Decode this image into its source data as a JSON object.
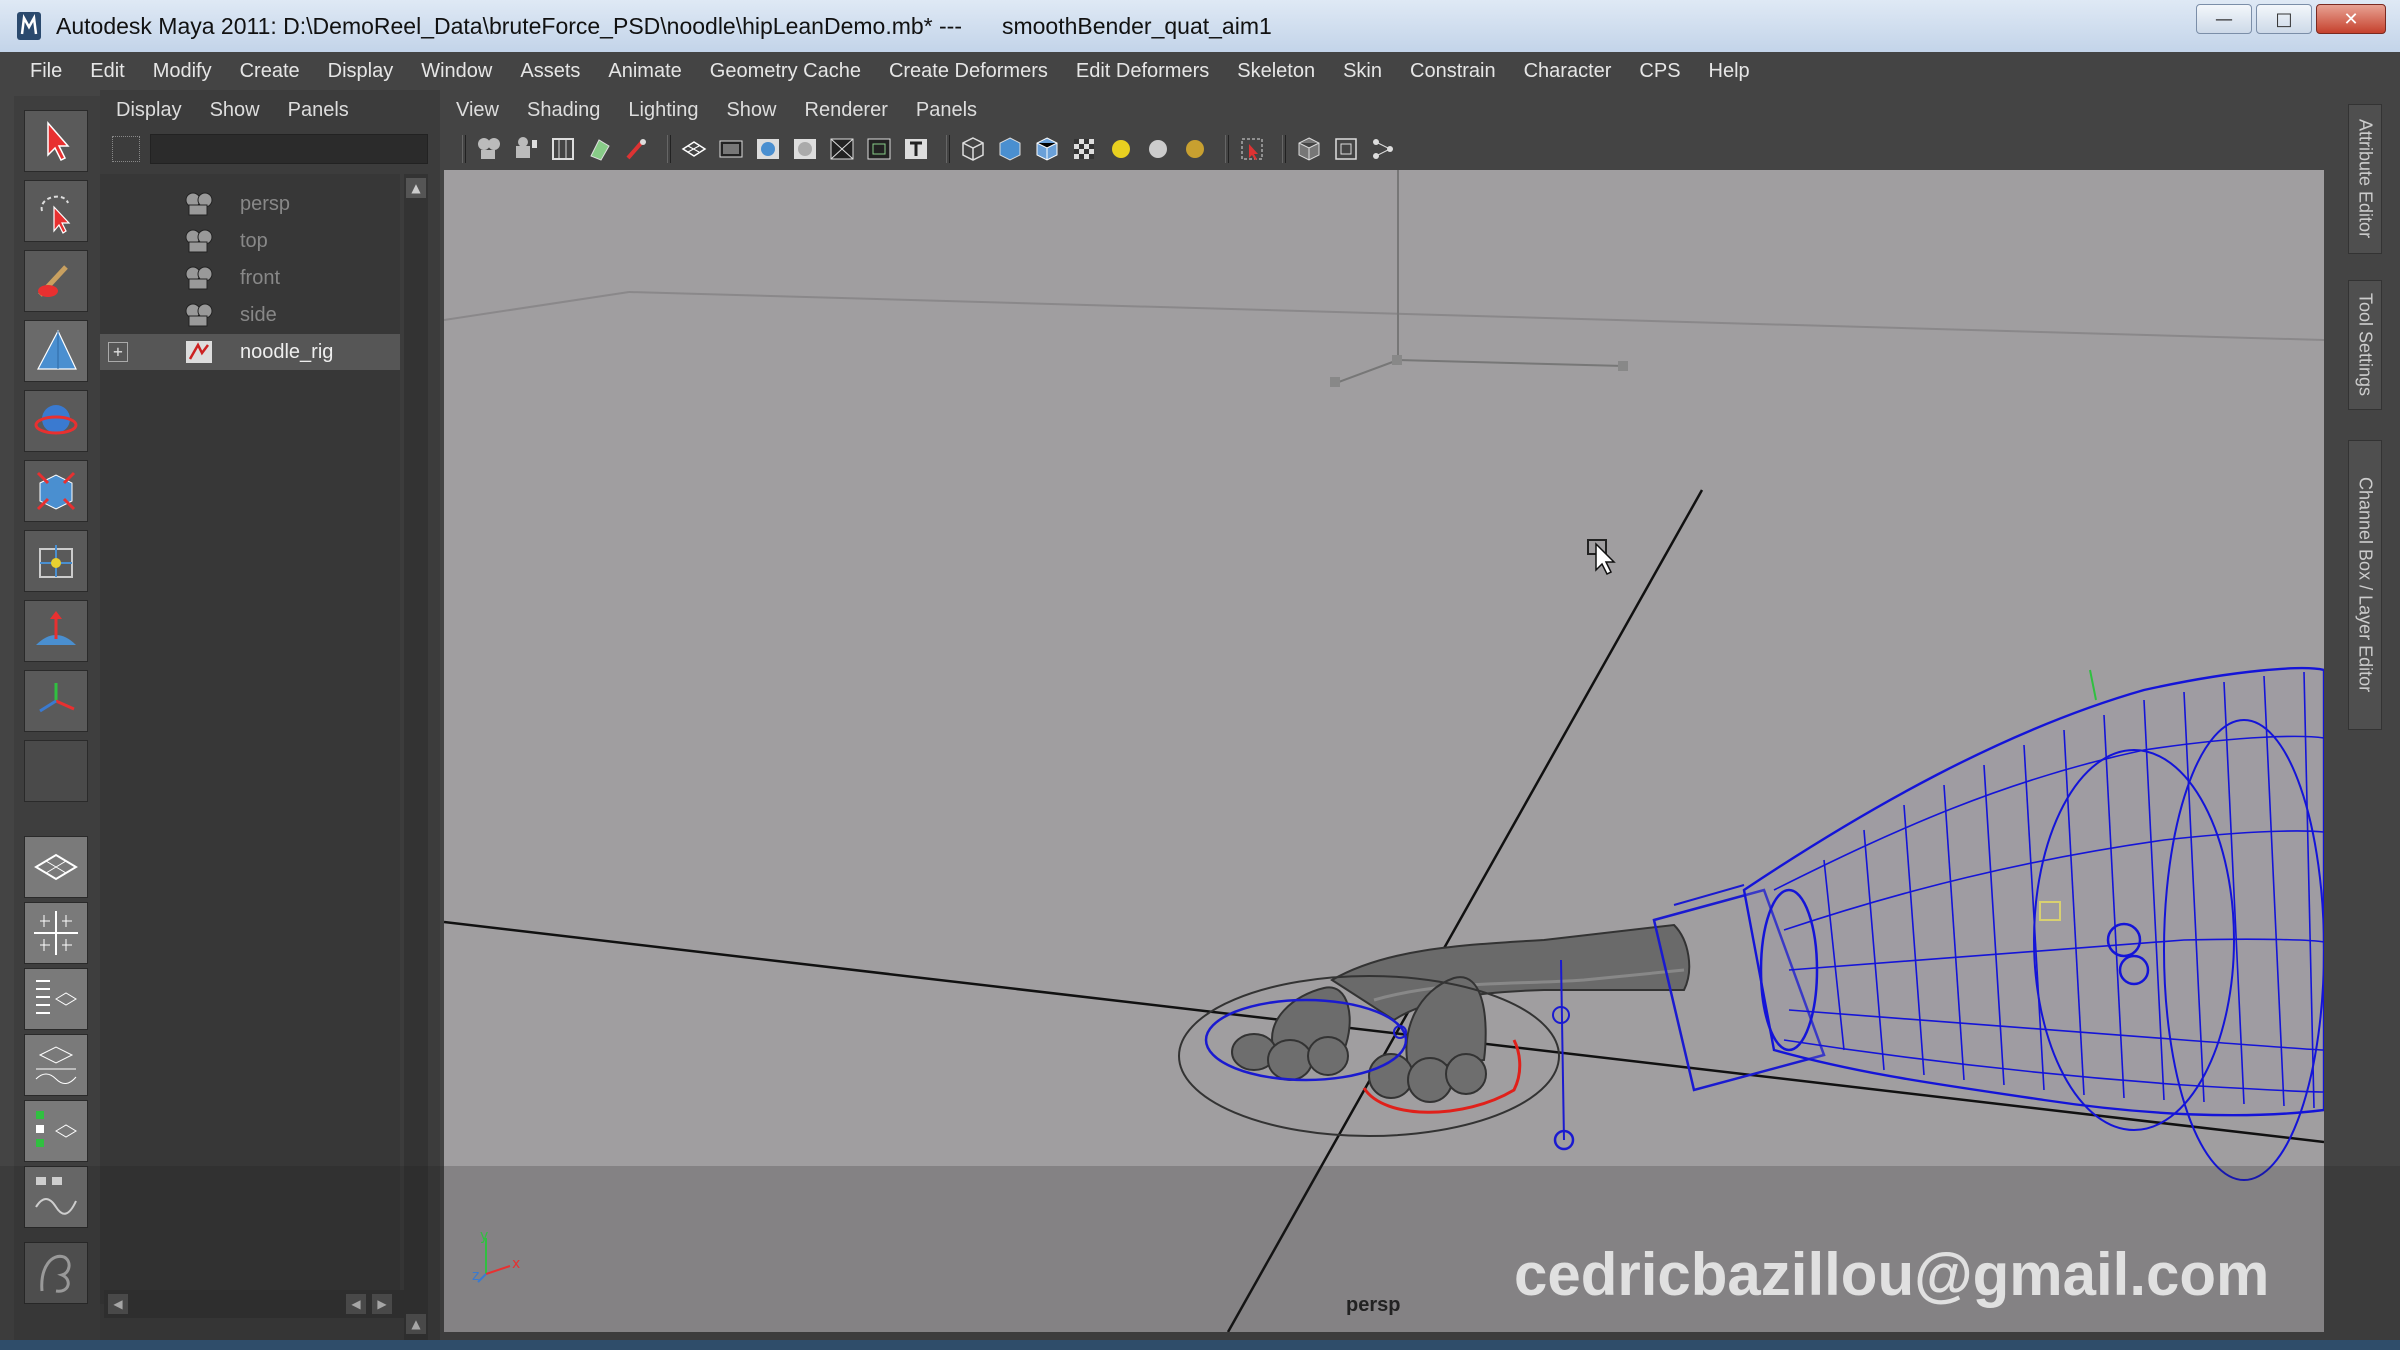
{
  "window": {
    "title": "Autodesk Maya 2011: D:\\DemoReel_Data\\bruteForce_PSD\\noodle\\hipLeanDemo.mb*   ---",
    "subtitle": "smoothBender_quat_aim1",
    "buttons": [
      "minimize-icon",
      "maximize-icon",
      "close-icon"
    ]
  },
  "main_menu": [
    "File",
    "Edit",
    "Modify",
    "Create",
    "Display",
    "Window",
    "Assets",
    "Animate",
    "Geometry Cache",
    "Create Deformers",
    "Edit Deformers",
    "Skeleton",
    "Skin",
    "Constrain",
    "Character",
    "CPS",
    "Help"
  ],
  "outliner": {
    "menu": [
      "Display",
      "Show",
      "Panels"
    ],
    "items": [
      {
        "label": "persp",
        "icon": "camera-icon"
      },
      {
        "label": "top",
        "icon": "camera-icon"
      },
      {
        "label": "front",
        "icon": "camera-icon"
      },
      {
        "label": "side",
        "icon": "camera-icon"
      },
      {
        "label": "noodle_rig",
        "icon": "transform-icon",
        "expander": "+"
      }
    ]
  },
  "panel": {
    "menu": [
      "View",
      "Shading",
      "Lighting",
      "Show",
      "Renderer",
      "Panels"
    ],
    "camera_label": "persp"
  },
  "side_tabs": [
    "Attribute Editor",
    "Tool Settings",
    "Channel Box / Layer Editor"
  ],
  "watermark": "cedricbazillou@gmail.com",
  "colors": {
    "viewport_bg": "#a09ea0",
    "wireframe": "#1414d8",
    "selection_red": "#e0201a",
    "ui_dark": "#444444"
  }
}
